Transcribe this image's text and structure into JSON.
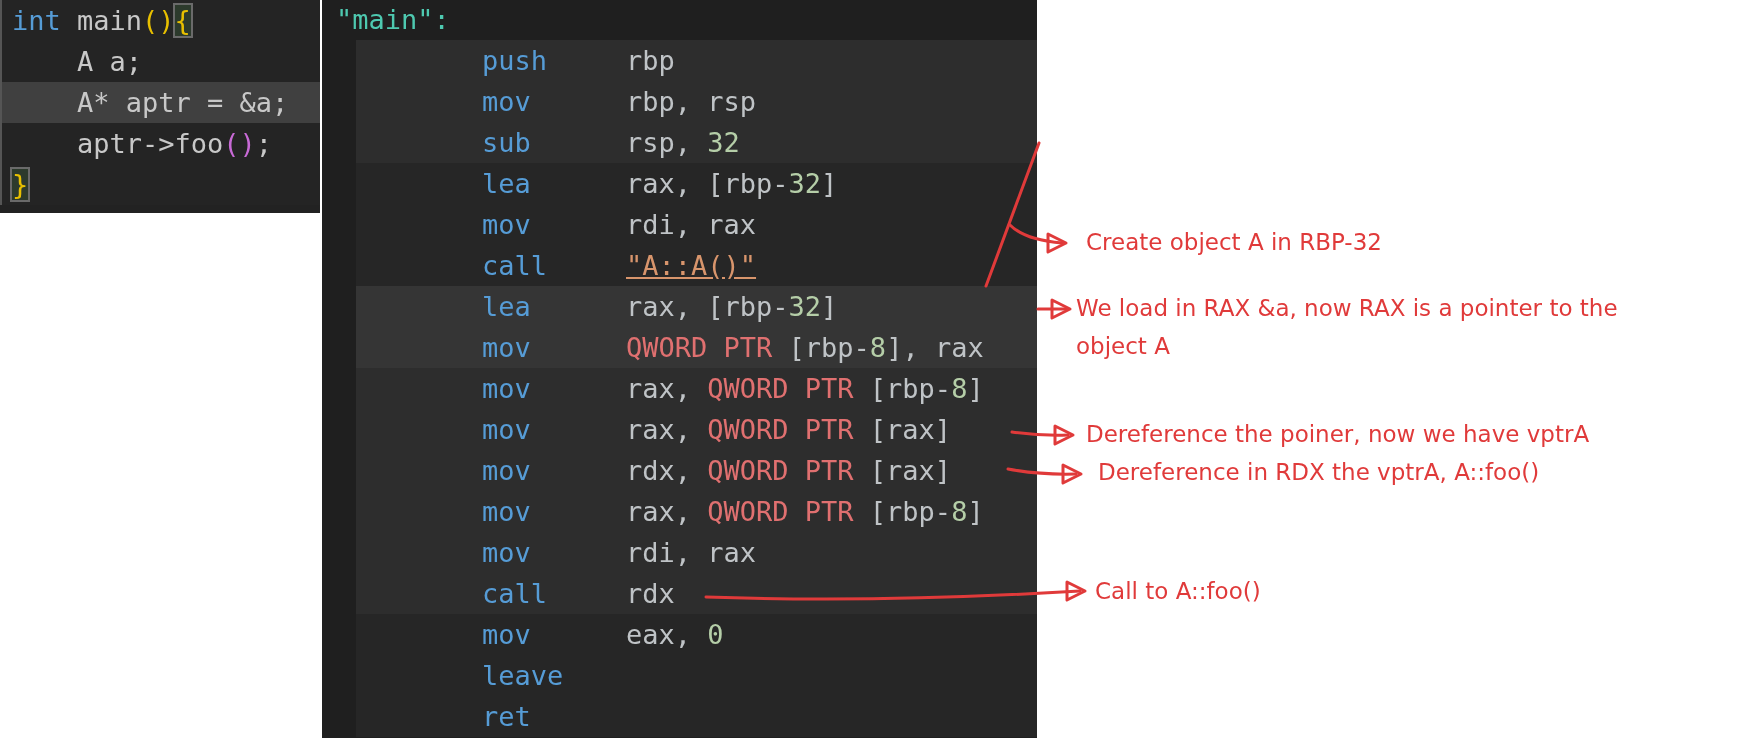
{
  "source": {
    "lines": [
      {
        "highlighted": false,
        "tokens": [
          {
            "kind": "keyword",
            "text": "int"
          },
          {
            "kind": "plain",
            "text": " main"
          },
          {
            "kind": "paren",
            "text": "()"
          },
          {
            "kind": "brace",
            "text": "{"
          }
        ]
      },
      {
        "highlighted": false,
        "tokens": [
          {
            "kind": "plain",
            "text": "    A a;"
          }
        ]
      },
      {
        "highlighted": true,
        "tokens": [
          {
            "kind": "plain",
            "text": "    A* aptr = &a;"
          }
        ]
      },
      {
        "highlighted": false,
        "tokens": [
          {
            "kind": "plain",
            "text": "    aptr->foo"
          },
          {
            "kind": "paren2",
            "text": "()"
          },
          {
            "kind": "plain",
            "text": ";"
          }
        ]
      },
      {
        "highlighted": false,
        "tokens": [
          {
            "kind": "brace",
            "text": "}"
          }
        ]
      }
    ]
  },
  "assembly": {
    "label": "\"main\":",
    "blocks": [
      {
        "kind": "mid",
        "lines": [
          {
            "mnemonic": "push",
            "operands": [
              {
                "kind": "reg",
                "text": "rbp"
              }
            ]
          },
          {
            "mnemonic": "mov",
            "operands": [
              {
                "kind": "reg",
                "text": "rbp, rsp"
              }
            ]
          },
          {
            "mnemonic": "sub",
            "operands": [
              {
                "kind": "reg",
                "text": "rsp, "
              },
              {
                "kind": "num",
                "text": "32"
              }
            ]
          }
        ]
      },
      {
        "kind": "dark",
        "lines": [
          {
            "mnemonic": "lea",
            "operands": [
              {
                "kind": "reg",
                "text": "rax, [rbp-"
              },
              {
                "kind": "num",
                "text": "32"
              },
              {
                "kind": "reg",
                "text": "]"
              }
            ]
          },
          {
            "mnemonic": "mov",
            "operands": [
              {
                "kind": "reg",
                "text": "rdi, rax"
              }
            ]
          },
          {
            "mnemonic": "call",
            "operands": [
              {
                "kind": "symbol",
                "text": "\"A::A()\""
              }
            ]
          }
        ]
      },
      {
        "kind": "bright",
        "lines": [
          {
            "mnemonic": "lea",
            "operands": [
              {
                "kind": "reg",
                "text": "rax, [rbp-"
              },
              {
                "kind": "num",
                "text": "32"
              },
              {
                "kind": "reg",
                "text": "]"
              }
            ]
          },
          {
            "mnemonic": "mov",
            "operands": [
              {
                "kind": "ptr",
                "text": "QWORD PTR"
              },
              {
                "kind": "reg",
                "text": " [rbp-"
              },
              {
                "kind": "num",
                "text": "8"
              },
              {
                "kind": "reg",
                "text": "], rax"
              }
            ]
          }
        ]
      },
      {
        "kind": "mid",
        "lines": [
          {
            "mnemonic": "mov",
            "operands": [
              {
                "kind": "reg",
                "text": "rax, "
              },
              {
                "kind": "ptr",
                "text": "QWORD PTR"
              },
              {
                "kind": "reg",
                "text": " [rbp-"
              },
              {
                "kind": "num",
                "text": "8"
              },
              {
                "kind": "reg",
                "text": "]"
              }
            ]
          },
          {
            "mnemonic": "mov",
            "operands": [
              {
                "kind": "reg",
                "text": "rax, "
              },
              {
                "kind": "ptr",
                "text": "QWORD PTR"
              },
              {
                "kind": "reg",
                "text": " [rax]"
              }
            ]
          },
          {
            "mnemonic": "mov",
            "operands": [
              {
                "kind": "reg",
                "text": "rdx, "
              },
              {
                "kind": "ptr",
                "text": "QWORD PTR"
              },
              {
                "kind": "reg",
                "text": " [rax]"
              }
            ]
          },
          {
            "mnemonic": "mov",
            "operands": [
              {
                "kind": "reg",
                "text": "rax, "
              },
              {
                "kind": "ptr",
                "text": "QWORD PTR"
              },
              {
                "kind": "reg",
                "text": " [rbp-"
              },
              {
                "kind": "num",
                "text": "8"
              },
              {
                "kind": "reg",
                "text": "]"
              }
            ]
          },
          {
            "mnemonic": "mov",
            "operands": [
              {
                "kind": "reg",
                "text": "rdi, rax"
              }
            ]
          },
          {
            "mnemonic": "call",
            "operands": [
              {
                "kind": "reg",
                "text": "rdx"
              }
            ]
          }
        ]
      },
      {
        "kind": "dark",
        "lines": [
          {
            "mnemonic": "mov",
            "operands": [
              {
                "kind": "reg",
                "text": "eax, "
              },
              {
                "kind": "num",
                "text": "0"
              }
            ]
          },
          {
            "mnemonic": "leave"
          },
          {
            "mnemonic": "ret"
          }
        ]
      }
    ]
  },
  "annotations": [
    {
      "lines": [
        "Create object A in RBP-32"
      ]
    },
    {
      "lines": [
        "We load in RAX &a, now RAX is a pointer to the",
        "object A"
      ]
    },
    {
      "lines": [
        "Dereference the poiner, now we have vptrA"
      ]
    },
    {
      "lines": [
        "Dereference in RDX the vptrA, A::foo()"
      ]
    },
    {
      "lines": [
        "Call to A::foo()"
      ]
    }
  ]
}
